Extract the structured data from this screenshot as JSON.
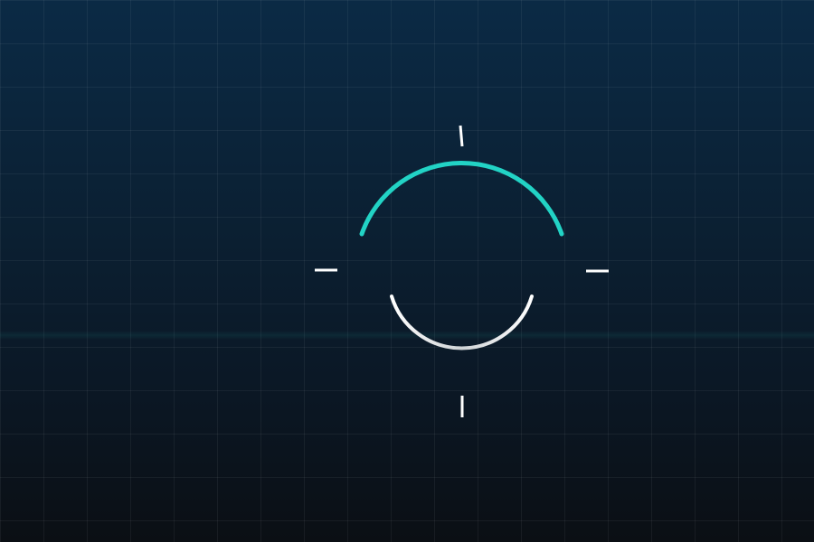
{
  "scene": {
    "name": "aiming-reticle-view",
    "colors": {
      "background_top": "#0b2a45",
      "background_bottom": "#0b0f14",
      "grid_line": "rgba(255,255,255,0.055)",
      "reticle_top_arc": "#22d3c5",
      "reticle_bottom_arc": "#ffffff",
      "reticle_ticks": "#ffffff"
    },
    "icons": {
      "reticle": "crosshair-icon",
      "top_arc": "arc-icon",
      "bottom_arc": "arc-icon",
      "ticks": "tick-mark-icon"
    }
  }
}
